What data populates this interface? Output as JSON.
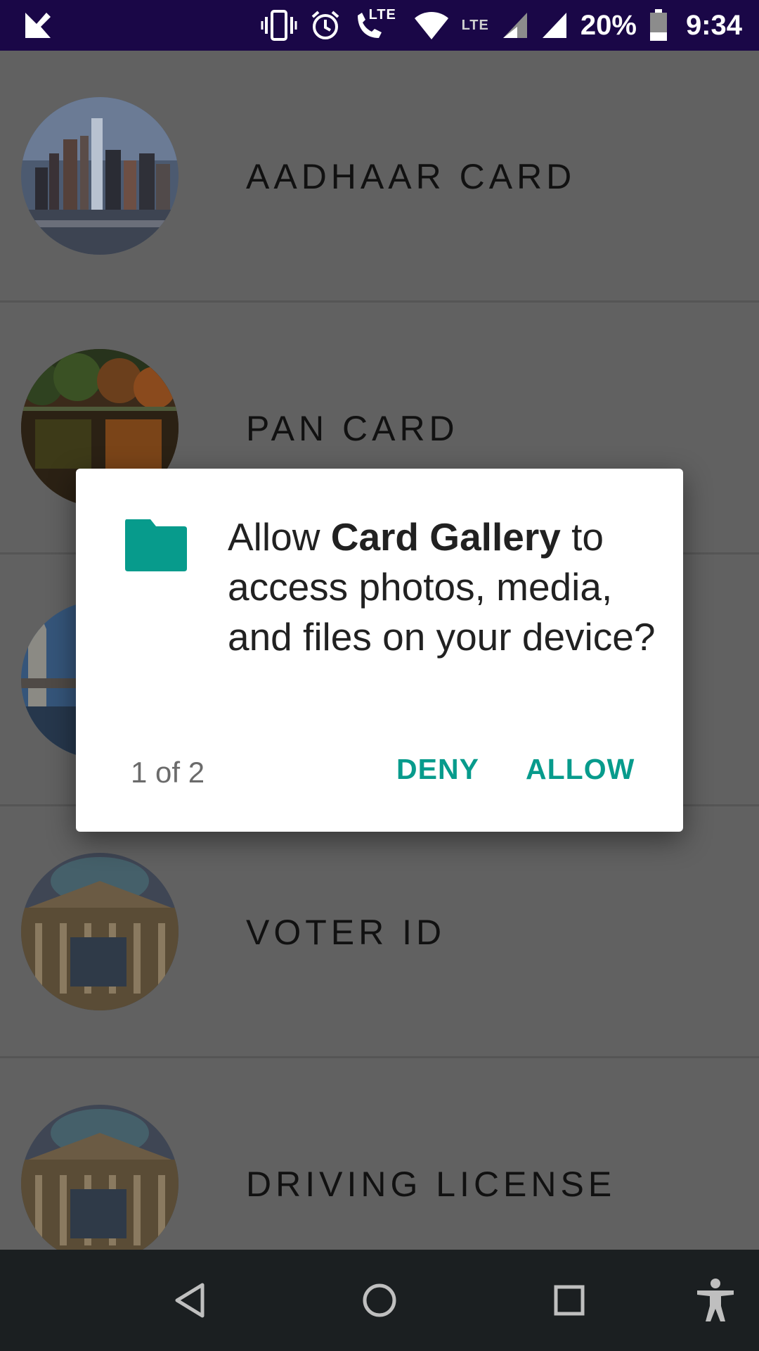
{
  "status_bar": {
    "battery": "20%",
    "time": "9:34",
    "lte_label_1": "LTE",
    "lte_label_2": "LTE",
    "icons": [
      "app-check-icon",
      "vibrate-icon",
      "alarm-icon",
      "volte-call-icon",
      "wifi-icon",
      "signal-icon",
      "signal-icon",
      "battery-icon"
    ]
  },
  "list": {
    "items": [
      {
        "label": "AADHAAR CARD",
        "image": "city-skyline-photo"
      },
      {
        "label": "PAN CARD",
        "image": "autumn-lake-photo"
      },
      {
        "label": "",
        "image": "bridge-photo"
      },
      {
        "label": "VOTER ID",
        "image": "parliament-building-photo"
      },
      {
        "label": "DRIVING LICENSE",
        "image": "parliament-building-photo"
      }
    ]
  },
  "dialog": {
    "message_pre": "Allow ",
    "app_name": "Card Gallery",
    "message_post": " to access photos, media, and files on your device?",
    "count": "1 of 2",
    "deny_label": "DENY",
    "allow_label": "ALLOW",
    "icon": "folder-icon",
    "accent_color": "#079b8c"
  },
  "nav_bar": {
    "icons": [
      "back-icon",
      "home-icon",
      "recents-icon",
      "accessibility-icon"
    ]
  }
}
